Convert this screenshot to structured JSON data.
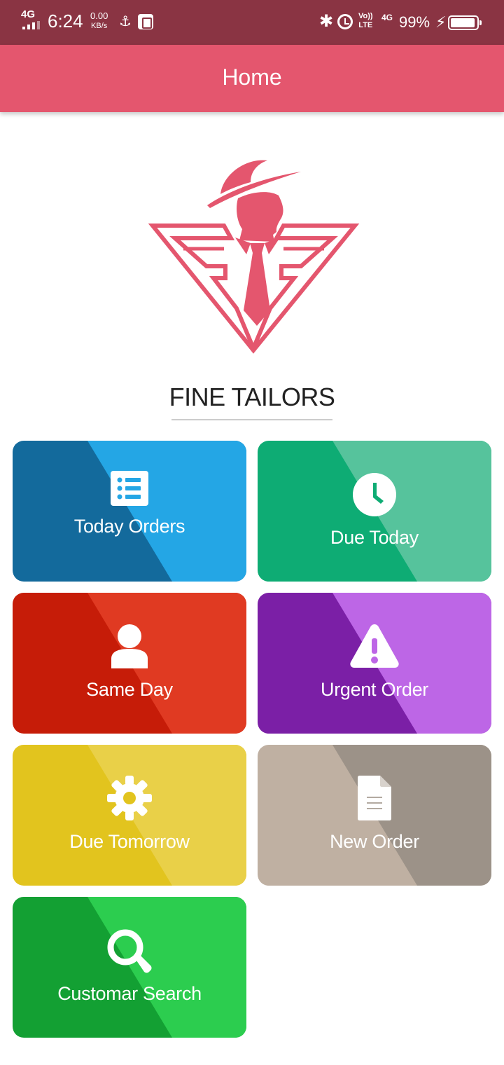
{
  "status_bar": {
    "network": "4G",
    "time": "6:24",
    "speed_value": "0.00",
    "speed_unit": "KB/s",
    "volte_top": "Vo))",
    "volte_bottom": "LTE",
    "network2": "4G",
    "battery": "99%"
  },
  "app_bar": {
    "title": "Home"
  },
  "brand": {
    "name": "FINE TAILORS"
  },
  "tiles": [
    {
      "label": "Today Orders",
      "icon": "list-icon",
      "color_dark": "#136a9c",
      "color_light": "#24a6e5"
    },
    {
      "label": "Due Today",
      "icon": "clock-icon",
      "color_dark": "#0eac74",
      "color_light": "#56c39c"
    },
    {
      "label": "Same Day",
      "icon": "user-icon",
      "color_dark": "#c61c08",
      "color_light": "#e03a22"
    },
    {
      "label": "Urgent Order",
      "icon": "warning-icon",
      "color_dark": "#7b1fa6",
      "color_light": "#bd66e6"
    },
    {
      "label": "Due Tomorrow",
      "icon": "gear-icon",
      "color_dark": "#e2c41e",
      "color_light": "#e9d048"
    },
    {
      "label": "New Order",
      "icon": "document-icon",
      "color_dark": "#bfb0a2",
      "color_light": "#9c9288"
    },
    {
      "label": "Customar Search",
      "icon": "search-icon",
      "color_dark": "#13a033",
      "color_light": "#2ccd4f"
    }
  ]
}
